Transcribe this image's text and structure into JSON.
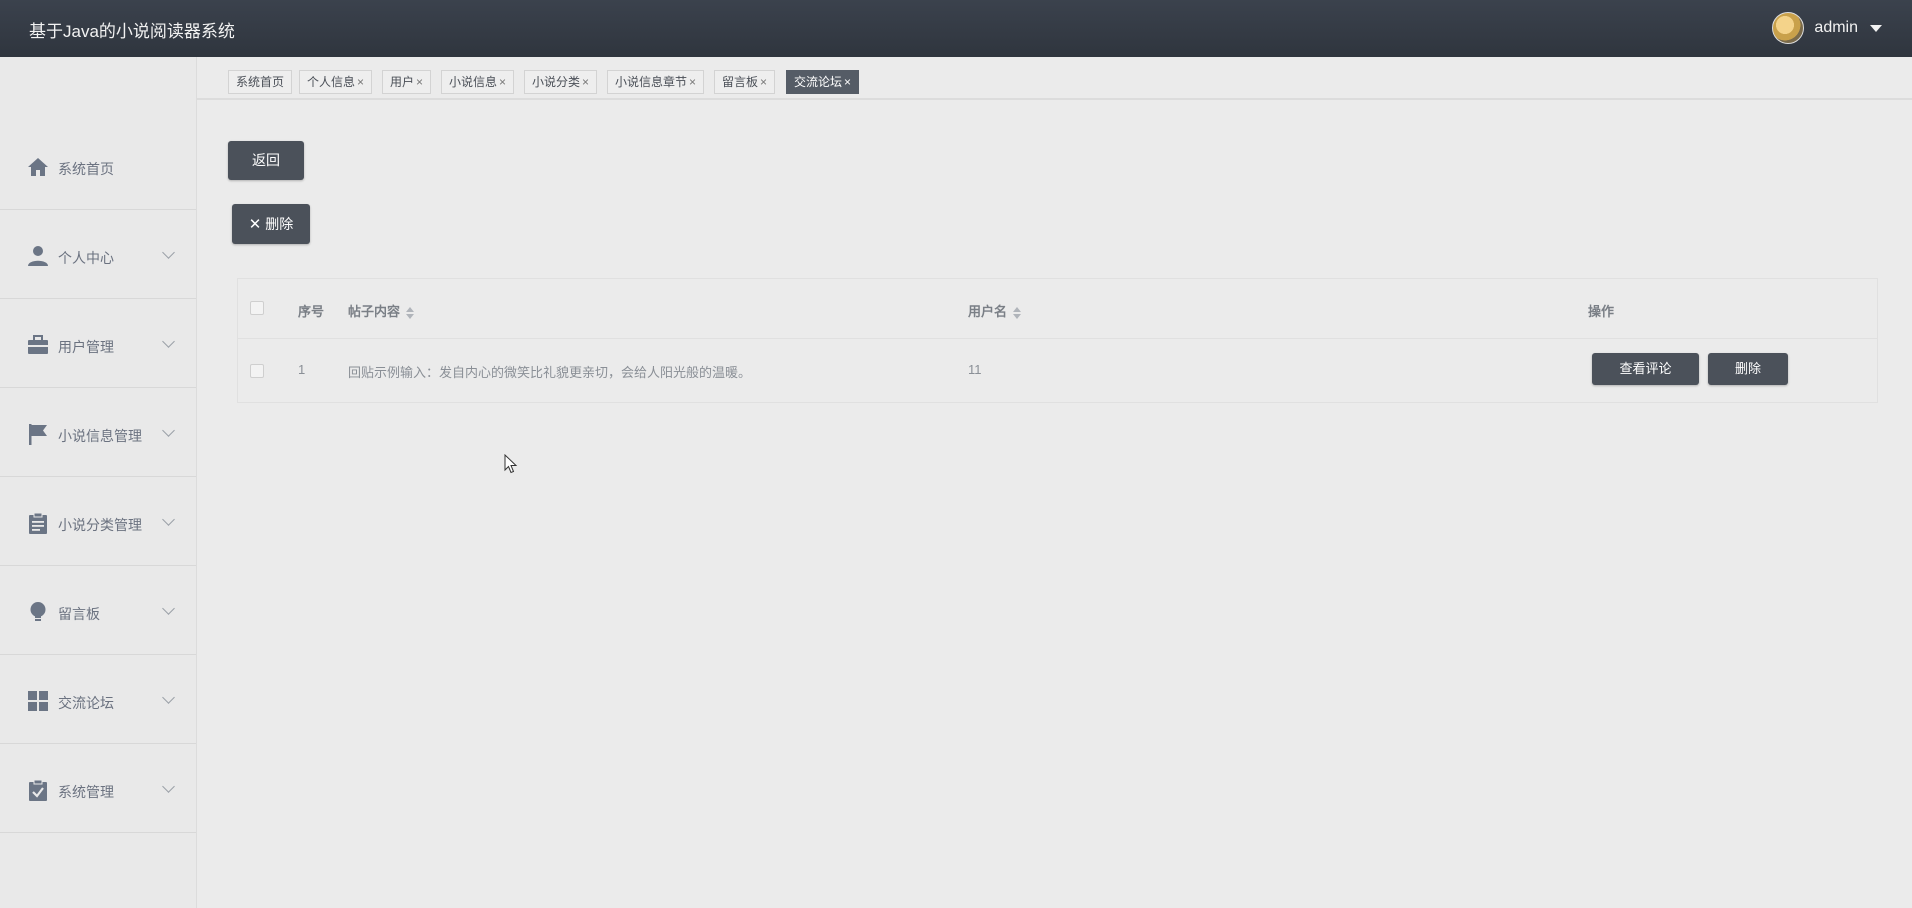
{
  "header": {
    "title": "基于Java的小说阅读器系统",
    "user_name": "admin"
  },
  "sidebar": {
    "items": [
      {
        "label": "系统首页",
        "icon": "home-icon"
      },
      {
        "label": "个人中心",
        "icon": "user-icon"
      },
      {
        "label": "用户管理",
        "icon": "briefcase-icon"
      },
      {
        "label": "小说信息管理",
        "icon": "flag-icon"
      },
      {
        "label": "小说分类管理",
        "icon": "clipboard-icon"
      },
      {
        "label": "留言板",
        "icon": "lightbulb-icon"
      },
      {
        "label": "交流论坛",
        "icon": "grid-icon"
      },
      {
        "label": "系统管理",
        "icon": "clipboard-check-icon"
      }
    ]
  },
  "tabs": [
    {
      "label": "系统首页",
      "closable": false
    },
    {
      "label": "个人信息",
      "closable": true
    },
    {
      "label": "用户",
      "closable": true
    },
    {
      "label": "小说信息",
      "closable": true
    },
    {
      "label": "小说分类",
      "closable": true
    },
    {
      "label": "小说信息章节",
      "closable": true
    },
    {
      "label": "留言板",
      "closable": true
    },
    {
      "label": "交流论坛",
      "closable": true,
      "active": true
    }
  ],
  "tab_close_glyph": "×",
  "main": {
    "back_label": "返回",
    "delete_label": "删除",
    "table": {
      "columns": {
        "index": "序号",
        "content": "帖子内容",
        "username": "用户名",
        "actions": "操作"
      },
      "rows": [
        {
          "index": "1",
          "content": "回贴示例输入：发自内心的微笑比礼貌更亲切，会给人阳光般的温暖。",
          "username": "11",
          "view_comments_label": "查看评论",
          "delete_label": "删除"
        }
      ]
    }
  },
  "colors": {
    "header_bg": "#343a43",
    "dark_button": "#4b515a",
    "active_tab": "#555c66",
    "page_bg": "#ebebeb"
  }
}
